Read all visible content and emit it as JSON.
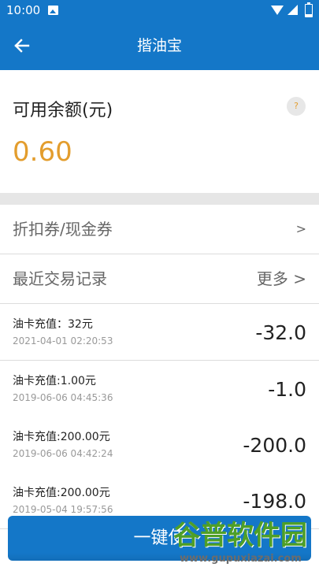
{
  "status_bar": {
    "time": "10:00"
  },
  "header": {
    "title": "揩油宝"
  },
  "balance": {
    "label": "可用余额(元)",
    "value": "0.60",
    "help_symbol": "?"
  },
  "menu": {
    "coupons_label": "折扣券/现金券",
    "coupons_arrow": ">",
    "recent_label": "最近交易记录",
    "more_label": "更多 >"
  },
  "transactions": [
    {
      "title": "油卡充值：32元",
      "time": "2021-04-01  02:20:53",
      "amount": "-32.0"
    },
    {
      "title": "油卡充值:1.00元",
      "time": "2019-06-06  04:45:36",
      "amount": "-1.0"
    },
    {
      "title": "油卡充值:200.00元",
      "time": "2019-06-06  04:42:24",
      "amount": "-200.0"
    },
    {
      "title": "油卡充值:200.00元",
      "time": "2019-05-04  19:57:56",
      "amount": "-198.0"
    }
  ],
  "bottom_button": {
    "label": "一键使"
  },
  "watermark": {
    "main": "谷普软件园",
    "url": "www.gupuxiazai.com"
  },
  "colors": {
    "primary": "#1477c8",
    "balance": "#e39d2d",
    "watermark": "#4f9f27"
  }
}
